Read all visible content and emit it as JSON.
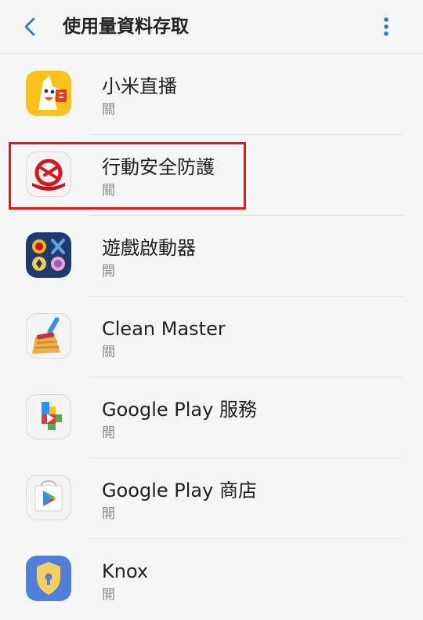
{
  "header": {
    "title": "使用量資料存取",
    "back_icon": "chevron-left-icon",
    "more_icon": "more-vertical-icon"
  },
  "accent_color": "#2f7cc4",
  "apps": [
    {
      "name": "小米直播",
      "state": "關",
      "icon": "xiaomi-live-icon"
    },
    {
      "name": "行動安全防護",
      "state": "關",
      "icon": "mobile-security-icon"
    },
    {
      "name": "遊戲啟動器",
      "state": "開",
      "icon": "game-launcher-icon"
    },
    {
      "name": "Clean Master",
      "state": "關",
      "icon": "broom-icon"
    },
    {
      "name": "Google Play 服務",
      "state": "開",
      "icon": "google-play-services-icon"
    },
    {
      "name": "Google Play 商店",
      "state": "開",
      "icon": "google-play-store-icon"
    },
    {
      "name": "Knox",
      "state": "開",
      "icon": "shield-lock-icon"
    }
  ]
}
